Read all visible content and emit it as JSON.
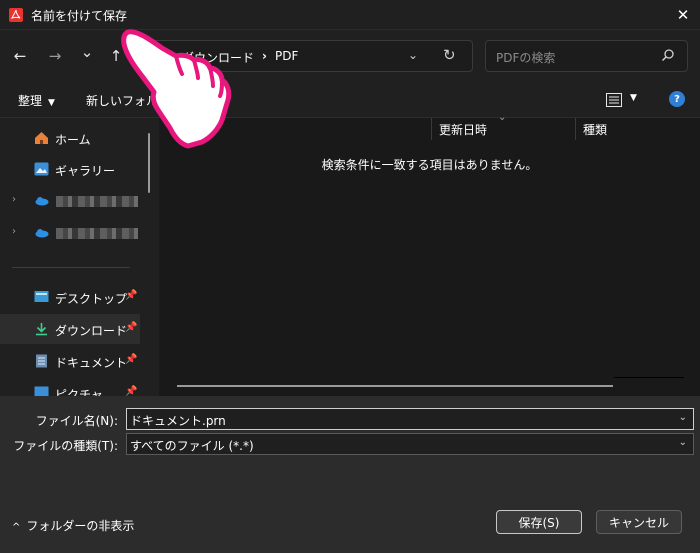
{
  "window": {
    "title": "名前を付けて保存",
    "close_symbol": "✕"
  },
  "nav": {
    "back_symbol": "←",
    "forward_symbol": "→",
    "recent_symbol": "⌄",
    "up_symbol": "↑",
    "breadcrumb": [
      "ダウンロード",
      "PDF"
    ],
    "breadcrumb_sep": "›",
    "address_dropdown_symbol": "⌄",
    "refresh_symbol": "↻",
    "search_placeholder": "PDFの検索"
  },
  "command_bar": {
    "organize_label": "整理",
    "organize_caret": "▼",
    "new_folder_label": "新しいフォル",
    "view_caret": "▼",
    "help_symbol": "?"
  },
  "sidebar": {
    "items": [
      {
        "label": "ホーム",
        "icon": "home-icon"
      },
      {
        "label": "ギャラリー",
        "icon": "gallery-icon"
      },
      {
        "label": "",
        "icon": "onedrive-icon",
        "expand": "›"
      },
      {
        "label": "",
        "icon": "onedrive-icon",
        "expand": "›"
      },
      {
        "label": "デスクトップ",
        "icon": "desktop-icon",
        "pin": "📌"
      },
      {
        "label": "ダウンロード",
        "icon": "download-icon",
        "pin": "📌"
      },
      {
        "label": "ドキュメント",
        "icon": "document-icon",
        "pin": "📌"
      },
      {
        "label": "ピクチャ",
        "icon": "pictures-icon",
        "pin": "📌"
      }
    ]
  },
  "file_list": {
    "columns": [
      "更新日時",
      "種類"
    ],
    "sort_caret": "⌄",
    "empty_message": "検索条件に一致する項目はありません。"
  },
  "form": {
    "filename_label": "ファイル名(N):",
    "filename_value": "ドキュメント.prn",
    "filetype_label": "ファイルの種類(T):",
    "filetype_value": "すべてのファイル (*.*)",
    "dropdown_symbol": "⌄"
  },
  "footer": {
    "hide_folders_caret": "^",
    "hide_folders_label": "フォルダーの非表示",
    "save_label": "保存(S)",
    "cancel_label": "キャンセル"
  },
  "colors": {
    "accent": "#e8177e",
    "help": "#2f7fd6",
    "dialog_bg": "#202020",
    "bottom_bg": "#2c2c2c"
  }
}
